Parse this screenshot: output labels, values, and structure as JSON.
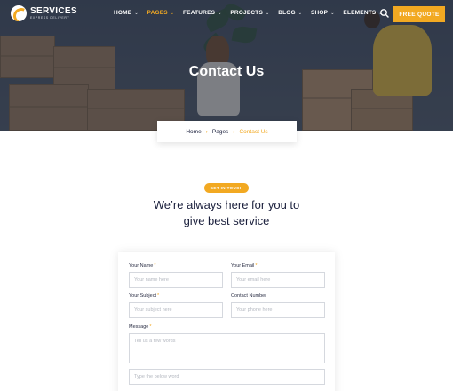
{
  "brand": {
    "name": "SERVICES",
    "tagline": "EXPRESS DELIVERY"
  },
  "nav": {
    "items": [
      {
        "label": "HOME",
        "active": false
      },
      {
        "label": "PAGES",
        "active": true
      },
      {
        "label": "FEATURES",
        "active": false
      },
      {
        "label": "PROJECTS",
        "active": false
      },
      {
        "label": "BLOG",
        "active": false
      },
      {
        "label": "SHOP",
        "active": false
      },
      {
        "label": "ELEMENTS",
        "active": false
      }
    ],
    "quote_button": "FREE QUOTE"
  },
  "hero": {
    "title": "Contact Us"
  },
  "breadcrumb": {
    "items": [
      "Home",
      "Pages",
      "Contact Us"
    ]
  },
  "section": {
    "badge": "GET IN TOUCH",
    "headline_line1": "We’re always here for you to",
    "headline_line2": "give best service"
  },
  "form": {
    "name_label": "Your Name",
    "name_placeholder": "Your name here",
    "email_label": "Your Email",
    "email_placeholder": "Your email here",
    "subject_label": "Your Subject",
    "subject_placeholder": "Your subject here",
    "phone_label": "Contact Number",
    "phone_placeholder": "Your phone here",
    "message_label": "Message",
    "message_placeholder": "Tell us a few words",
    "captcha_placeholder": "Type the below word",
    "required_mark": "*"
  },
  "colors": {
    "accent": "#f2a922",
    "text_dark": "#1a1f3c"
  }
}
